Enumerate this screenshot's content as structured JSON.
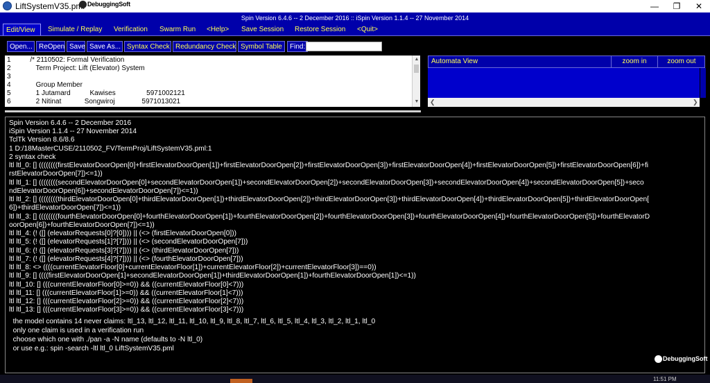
{
  "window": {
    "title": "LiftSystemV35.pml",
    "logo_text": "DebuggingSoft",
    "controls": {
      "minimize": "—",
      "maximize": "❐",
      "close": "✕"
    }
  },
  "version_bar": "Spin Version 6.4.6 -- 2 December 2016 :: iSpin Version 1.1.4 -- 27 November 2014",
  "menu": [
    {
      "label": "Edit/View"
    },
    {
      "label": "Simulate / Replay"
    },
    {
      "label": "Verification"
    },
    {
      "label": "Swarm Run"
    },
    {
      "label": "<Help>"
    },
    {
      "label": "Save Session"
    },
    {
      "label": "Restore Session"
    },
    {
      "label": "<Quit>"
    }
  ],
  "toolbar": {
    "open": "Open...",
    "reopen": "ReOpen",
    "save": "Save",
    "save_as": "Save As...",
    "syntax_check": "Syntax Check",
    "redundancy_check": "Redundancy Check",
    "symbol_table": "Symbol Table",
    "find_label": "Find:",
    "find_value": ""
  },
  "editor": {
    "lines": [
      {
        "n": "1",
        "text": "          /* 2110502: Formal Verification"
      },
      {
        "n": "2",
        "text": "             Term Project: Lift (Elevator) System"
      },
      {
        "n": "3",
        "text": ""
      },
      {
        "n": "4",
        "text": "             Group Member"
      },
      {
        "n": "5",
        "text": "             1 Jutamard          Kawises                5971002121"
      },
      {
        "n": "6",
        "text": "             2 Nitinat            Songwiroj              5971013021"
      }
    ]
  },
  "automata": {
    "title": "Automata View",
    "zoom_in": "zoom in",
    "zoom_out": "zoom out"
  },
  "console": {
    "lines": [
      "Spin Version 6.4.6 -- 2 December 2016",
      "iSpin Version 1.1.4 -- 27 November 2014",
      "TclTk Version 8.6/8.6",
      "1 D:/18MasterCUSE/2110502_FV/TermProj/LiftSystemV35.pml:1",
      "2 syntax check",
      "ltl ltl_0: [] ((((((((firstElevatorDoorOpen[0]+firstElevatorDoorOpen[1])+firstElevatorDoorOpen[2])+firstElevatorDoorOpen[3])+firstElevatorDoorOpen[4])+firstElevatorDoorOpen[5])+firstElevatorDoorOpen[6])+fi",
      "rstElevatorDoorOpen[7])<=1))",
      "ltl ltl_1: [] ((((((((secondElevatorDoorOpen[0]+secondElevatorDoorOpen[1])+secondElevatorDoorOpen[2])+secondElevatorDoorOpen[3])+secondElevatorDoorOpen[4])+secondElevatorDoorOpen[5])+seco",
      "ndElevatorDoorOpen[6])+secondElevatorDoorOpen[7])<=1))",
      "ltl ltl_2: [] ((((((((thirdElevatorDoorOpen[0]+thirdElevatorDoorOpen[1])+thirdElevatorDoorOpen[2])+thirdElevatorDoorOpen[3])+thirdElevatorDoorOpen[4])+thirdElevatorDoorOpen[5])+thirdElevatorDoorOpen[",
      "6])+thirdElevatorDoorOpen[7])<=1))",
      "ltl ltl_3: [] ((((((((fourthElevatorDoorOpen[0]+fourthElevatorDoorOpen[1])+fourthElevatorDoorOpen[2])+fourthElevatorDoorOpen[3])+fourthElevatorDoorOpen[4])+fourthElevatorDoorOpen[5])+fourthElevatorD",
      "oorOpen[6])+fourthElevatorDoorOpen[7])<=1))",
      "ltl ltl_4: (! ([] (elevatorRequests[0]?[0]))) || (<> (firstElevatorDoorOpen[0]))",
      "ltl ltl_5: (! ([] (elevatorRequests[1]?[7]))) || (<> (secondElevatorDoorOpen[7]))",
      "ltl ltl_6: (! ([] (elevatorRequests[3]?[7]))) || (<> (thirdElevatorDoorOpen[7]))",
      "ltl ltl_7: (! ([] (elevatorRequests[4]?[7]))) || (<> (fourthElevatorDoorOpen[7]))",
      "ltl ltl_8: <> ((((currentElevatorFloor[0]+currentElevatorFloor[1])+currentElevatorFloor[2])+currentElevatorFloor[3])==0))",
      "ltl ltl_9: [] ((((firstElevatorDoorOpen[1]+secondElevatorDoorOpen[1])+thirdElevatorDoorOpen[1])+fourthElevatorDoorOpen[1])<=1))",
      "ltl ltl_10: [] (((currentElevatorFloor[0]>=0)) && ((currentElevatorFloor[0]<7)))",
      "ltl ltl_11: [] (((currentElevatorFloor[1]>=0)) && ((currentElevatorFloor[1]<7)))",
      "ltl ltl_12: [] (((currentElevatorFloor[2]>=0)) && ((currentElevatorFloor[2]<7)))",
      "ltl ltl_13: [] (((currentElevatorFloor[3]>=0)) && ((currentElevatorFloor[3]<7)))",
      "  the model contains 14 never claims: ltl_13, ltl_12, ltl_11, ltl_10, ltl_9, ltl_8, ltl_7, ltl_6, ltl_5, ltl_4, ltl_3, ltl_2, ltl_1, ltl_0",
      "  only one claim is used in a verification run",
      "  choose which one with ./pan -a -N name (defaults to -N ltl_0)",
      "  or use e.g.: spin -search -ltl ltl_0 LiftSystemV35.pml"
    ],
    "logo_text": "DebuggingSoft"
  },
  "taskbar": {
    "time": "11:51 PM"
  }
}
